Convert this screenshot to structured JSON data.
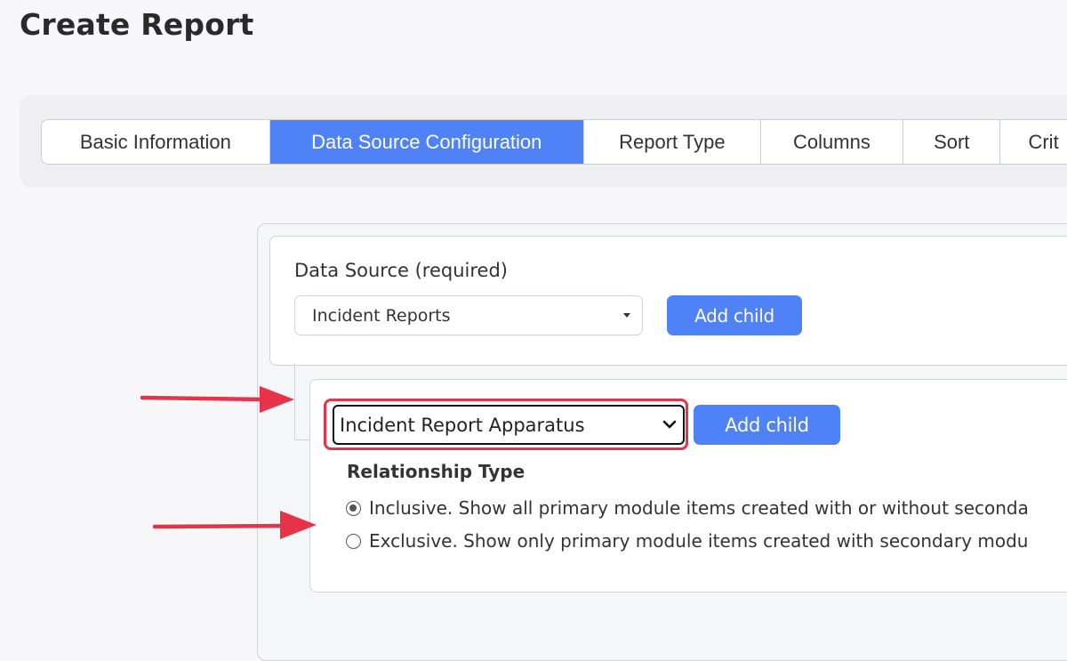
{
  "page": {
    "title": "Create Report"
  },
  "tabs": [
    {
      "label": "Basic Information",
      "active": false
    },
    {
      "label": "Data Source Configuration",
      "active": true
    },
    {
      "label": "Report Type",
      "active": false
    },
    {
      "label": "Columns",
      "active": false
    },
    {
      "label": "Sort",
      "active": false
    },
    {
      "label": "Crit",
      "active": false
    }
  ],
  "data_source": {
    "label": "Data Source (required)",
    "selected": "Incident Reports",
    "add_child_label": "Add child"
  },
  "child_source": {
    "selected": "Incident Report Apparatus",
    "add_child_label": "Add child"
  },
  "relationship": {
    "title": "Relationship Type",
    "options": [
      {
        "label": "Inclusive. Show all primary module items created with or without seconda",
        "checked": true
      },
      {
        "label": "Exclusive. Show only primary module items created with secondary modu",
        "checked": false
      }
    ]
  },
  "colors": {
    "accent": "#4f82f7",
    "highlight": "#e6334a",
    "arrow": "#e6334a"
  }
}
